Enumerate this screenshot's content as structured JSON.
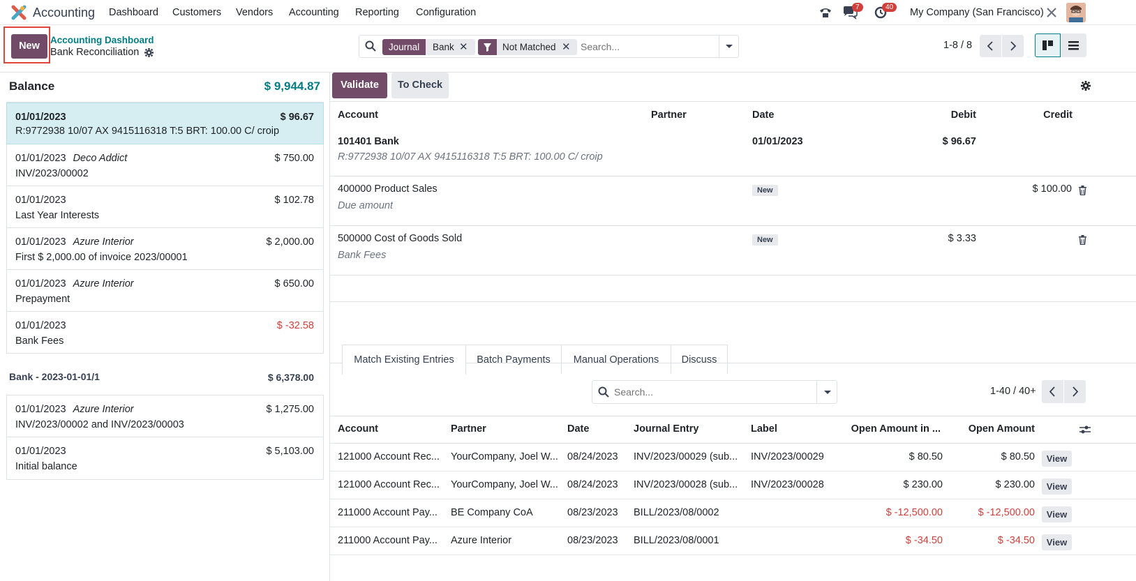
{
  "topbar": {
    "app_name": "Accounting",
    "menu": [
      "Dashboard",
      "Customers",
      "Vendors",
      "Accounting",
      "Reporting",
      "Configuration"
    ],
    "messages_count": "7",
    "activities_count": "40",
    "company": "My Company (San Francisco)"
  },
  "control": {
    "new_label": "New",
    "breadcrumb_parent": "Accounting Dashboard",
    "breadcrumb_current": "Bank Reconciliation",
    "facet1_label": "Journal",
    "facet1_value": "Bank",
    "facet2_value": "Not Matched",
    "search_placeholder": "Search...",
    "pager": "1-8 / 8"
  },
  "left": {
    "balance_label": "Balance",
    "balance_value": "$ 9,944.87",
    "lines": [
      {
        "date": "01/01/2023",
        "partner": "",
        "amount": "$ 96.67",
        "label": "R:9772938 10/07 AX 9415116318 T:5 BRT: 100.00 C/ croip",
        "negative": false,
        "selected": true
      },
      {
        "date": "01/01/2023",
        "partner": "Deco Addict",
        "amount": "$ 750.00",
        "label": "INV/2023/00002",
        "negative": false
      },
      {
        "date": "01/01/2023",
        "partner": "",
        "amount": "$ 102.78",
        "label": "Last Year Interests",
        "negative": false
      },
      {
        "date": "01/01/2023",
        "partner": "Azure Interior",
        "amount": "$ 2,000.00",
        "label": "First $ 2,000.00 of invoice 2023/00001",
        "negative": false
      },
      {
        "date": "01/01/2023",
        "partner": "Azure Interior",
        "amount": "$ 650.00",
        "label": "Prepayment",
        "negative": false
      },
      {
        "date": "01/01/2023",
        "partner": "",
        "amount": "$ -32.58",
        "label": "Bank Fees",
        "negative": true
      }
    ],
    "statement_label": "Bank - 2023-01-01/1",
    "statement_value": "$ 6,378.00",
    "lines2": [
      {
        "date": "01/01/2023",
        "partner": "Azure Interior",
        "amount": "$ 1,275.00",
        "label": "INV/2023/00002 and INV/2023/00003",
        "negative": false
      },
      {
        "date": "01/01/2023",
        "partner": "",
        "amount": "$ 5,103.00",
        "label": "Initial balance",
        "negative": false
      }
    ]
  },
  "right": {
    "validate_label": "Validate",
    "tocheck_label": "To Check",
    "headers": {
      "account": "Account",
      "partner": "Partner",
      "date": "Date",
      "debit": "Debit",
      "credit": "Credit"
    },
    "entry": {
      "account": "101401 Bank",
      "label": "R:9772938 10/07 AX 9415116318 T:5 BRT: 100.00 C/ croip",
      "date": "01/01/2023",
      "debit": "$ 96.67"
    },
    "line1": {
      "account": "400000 Product Sales",
      "label": "Due amount",
      "badge": "New",
      "credit": "$ 100.00"
    },
    "line2": {
      "account": "500000 Cost of Goods Sold",
      "label": "Bank Fees",
      "badge": "New",
      "debit": "$ 3.33"
    },
    "tabs": [
      "Match Existing Entries",
      "Batch Payments",
      "Manual Operations",
      "Discuss"
    ],
    "search_placeholder": "Search...",
    "pager": "1-40 / 40+",
    "table_headers": [
      "Account",
      "Partner",
      "Date",
      "Journal Entry",
      "Label",
      "Open Amount in ...",
      "Open Amount"
    ],
    "rows": [
      {
        "account": "121000 Account Rec...",
        "partner": "YourCompany, Joel W...",
        "date": "08/24/2023",
        "journal_entry": "INV/2023/00029 (sub...",
        "label": "INV/2023/00029",
        "open_cur": "$ 80.50",
        "open": "$ 80.50",
        "negative": false,
        "action": "View"
      },
      {
        "account": "121000 Account Rec...",
        "partner": "YourCompany, Joel W...",
        "date": "08/24/2023",
        "journal_entry": "INV/2023/00028 (sub...",
        "label": "INV/2023/00028",
        "open_cur": "$ 230.00",
        "open": "$ 230.00",
        "negative": false,
        "action": "View"
      },
      {
        "account": "211000 Account Pay...",
        "partner": "BE Company CoA",
        "date": "08/23/2023",
        "journal_entry": "BILL/2023/08/0002",
        "label": "",
        "open_cur": "$ -12,500.00",
        "open": "$ -12,500.00",
        "negative": true,
        "action": "View"
      },
      {
        "account": "211000 Account Pay...",
        "partner": "Azure Interior",
        "date": "08/23/2023",
        "journal_entry": "BILL/2023/08/0001",
        "label": "",
        "open_cur": "$ -34.50",
        "open": "$ -34.50",
        "negative": true,
        "action": "View"
      }
    ]
  },
  "colors": {
    "brand": "#714b67",
    "teal": "#017e84",
    "selected_bg": "#d6eef2",
    "negative": "#d23f3a",
    "highlight_border": "#e0443c"
  }
}
